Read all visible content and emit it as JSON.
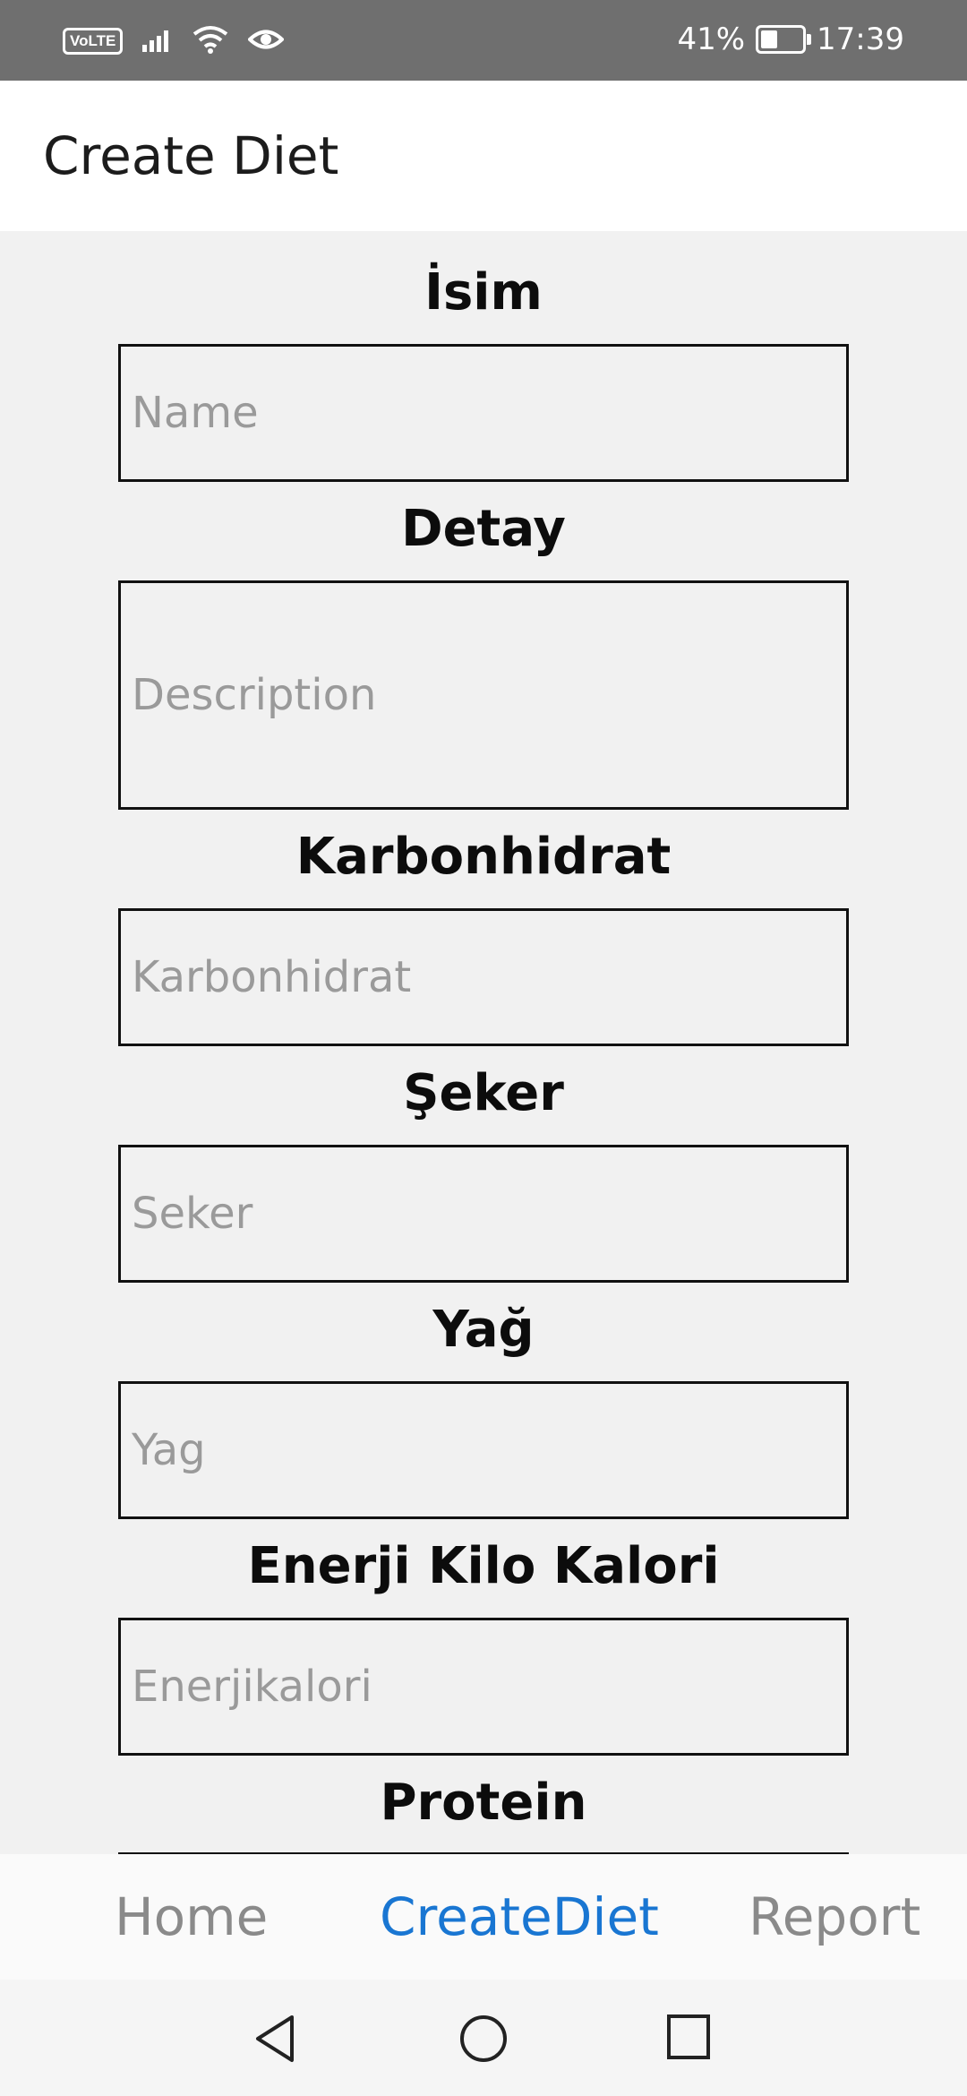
{
  "status_bar": {
    "volte": "VoLTE",
    "battery_percent_text": "41%",
    "battery_level": 0.41,
    "time": "17:39",
    "icons": [
      "signal-icon",
      "wifi-icon",
      "eye-icon",
      "battery-charging-icon"
    ]
  },
  "app_bar": {
    "title": "Create Diet"
  },
  "form": {
    "fields": [
      {
        "label": "İsim",
        "placeholder": "Name"
      },
      {
        "label": "Detay",
        "placeholder": "Description"
      },
      {
        "label": "Karbonhidrat",
        "placeholder": "Karbonhidrat"
      },
      {
        "label": "Şeker",
        "placeholder": "Seker"
      },
      {
        "label": "Yağ",
        "placeholder": "Yag"
      },
      {
        "label": "Enerji Kilo Kalori",
        "placeholder": "Enerjikalori"
      },
      {
        "label": "Protein",
        "placeholder": ""
      }
    ]
  },
  "bottom_nav": {
    "items": [
      {
        "label": "Home",
        "active": false
      },
      {
        "label": "CreateDiet",
        "active": true
      },
      {
        "label": "Report",
        "active": false
      }
    ],
    "active_color": "#1976d2",
    "inactive_color": "#8a8a8a"
  },
  "system_nav": {
    "icons": [
      "back-icon",
      "home-icon",
      "recents-icon"
    ]
  }
}
